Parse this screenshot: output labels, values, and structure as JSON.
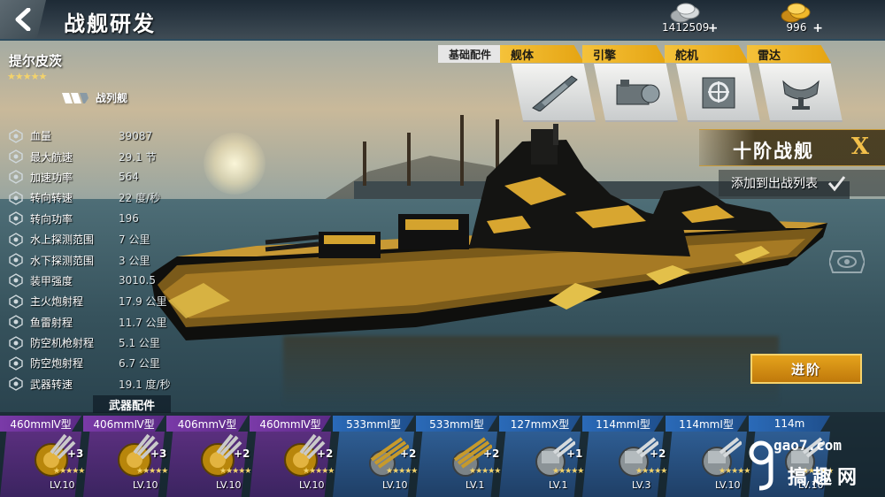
{
  "header": {
    "title": "战舰研发",
    "silver": "1412509",
    "gold": "996",
    "plus": "+"
  },
  "ship": {
    "name": "提尔皮茨",
    "rating_stars": 5,
    "class": "战列舰"
  },
  "stats": [
    {
      "label": "血量",
      "value": "39087"
    },
    {
      "label": "最大航速",
      "value": "29.1 节"
    },
    {
      "label": "加速功率",
      "value": "564"
    },
    {
      "label": "转向转速",
      "value": "22 度/秒"
    },
    {
      "label": "转向功率",
      "value": "196"
    },
    {
      "label": "水上探测范围",
      "value": "7 公里"
    },
    {
      "label": "水下探测范围",
      "value": "3 公里"
    },
    {
      "label": "装甲强度",
      "value": "3010.5"
    },
    {
      "label": "主火炮射程",
      "value": "17.9 公里"
    },
    {
      "label": "鱼雷射程",
      "value": "11.7 公里"
    },
    {
      "label": "防空机枪射程",
      "value": "5.1 公里"
    },
    {
      "label": "防空炮射程",
      "value": "6.7 公里"
    },
    {
      "label": "武器转速",
      "value": "19.1 度/秒"
    }
  ],
  "tabs": {
    "main": "基础配件",
    "items": [
      "舰体",
      "引擎",
      "舵机",
      "雷达"
    ]
  },
  "tier": {
    "label": "十阶战舰",
    "close": "X"
  },
  "add_to_list": {
    "label": "添加到出战列表",
    "checked": true
  },
  "upgrade_button": "进阶",
  "weapons_header": "武器配件",
  "weapons": [
    {
      "name": "460mmⅣ型",
      "bonus": "+3",
      "level": "LV.10",
      "rarity": "purple",
      "kind": "turret-gold"
    },
    {
      "name": "406mmⅣ型",
      "bonus": "+3",
      "level": "LV.10",
      "rarity": "purple",
      "kind": "turret-gold"
    },
    {
      "name": "406mmⅤ型",
      "bonus": "+2",
      "level": "LV.10",
      "rarity": "purple",
      "kind": "turret-gold"
    },
    {
      "name": "460mmⅣ型",
      "bonus": "+2",
      "level": "LV.10",
      "rarity": "purple",
      "kind": "turret-gold"
    },
    {
      "name": "533mmⅠ型",
      "bonus": "+2",
      "level": "LV.10",
      "rarity": "blue",
      "kind": "torpedo"
    },
    {
      "name": "533mmⅠ型",
      "bonus": "+2",
      "level": "LV.1",
      "rarity": "blue",
      "kind": "torpedo"
    },
    {
      "name": "127mmⅩ型",
      "bonus": "+1",
      "level": "LV.1",
      "rarity": "blue",
      "kind": "turret-grey"
    },
    {
      "name": "114mmⅠ型",
      "bonus": "+2",
      "level": "LV.3",
      "rarity": "blue",
      "kind": "turret-grey"
    },
    {
      "name": "114mmⅠ型",
      "bonus": "",
      "level": "LV.10",
      "rarity": "blue",
      "kind": "turret-grey"
    },
    {
      "name": "114m",
      "bonus": "",
      "level": "LV.10",
      "rarity": "blue",
      "kind": "turret-grey"
    }
  ],
  "watermark": {
    "site": "gao7.com",
    "name": "搞趣网"
  },
  "colors": {
    "accent_gold": "#f3c04a",
    "tab_yellow": "#f5c23a",
    "rarity_purple": "#6a3596",
    "rarity_blue": "#2a5f9e"
  }
}
